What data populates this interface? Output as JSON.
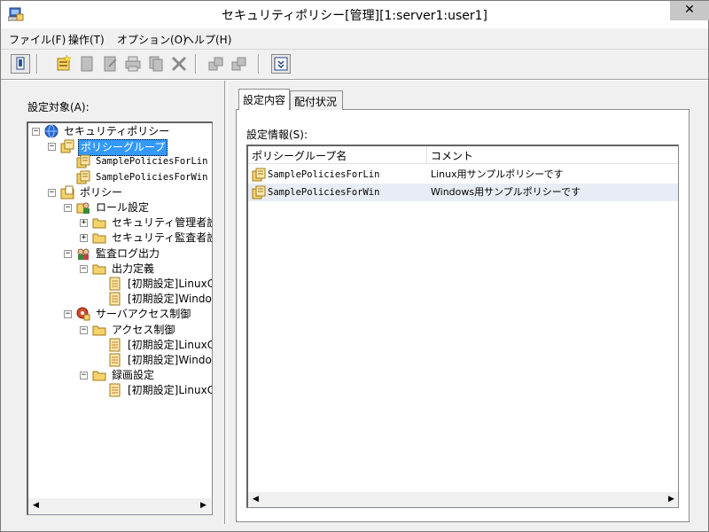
{
  "window": {
    "title": "セキュリティポリシー[管理][1:server1:user1]",
    "close_glyph": "✕"
  },
  "menu": [
    {
      "label": "ファイル(F)"
    },
    {
      "label": "操作(T)"
    },
    {
      "label": "オプション(O)"
    },
    {
      "label": "ヘルプ(H)"
    }
  ],
  "toolbar": {
    "buttons": [
      "open-icon",
      "new-policy-icon",
      "new-doc-icon",
      "edit-icon",
      "print-icon",
      "copy-icon",
      "delete-icon",
      "distribute-icon",
      "collect-icon",
      "dropdown-icon"
    ]
  },
  "left_pane": {
    "label": "設定対象(A):",
    "tree": [
      {
        "text": "セキュリティポリシー",
        "icon": "globe-icon",
        "expander": "−",
        "selected": false,
        "mono": false
      },
      {
        "text": "ポリシーグループ",
        "icon": "policy-group-icon",
        "expander": "−",
        "selected": true,
        "mono": false
      },
      {
        "text": "SamplePoliciesForLin",
        "icon": "policy-icon",
        "expander": "",
        "selected": false,
        "mono": true
      },
      {
        "text": "SamplePoliciesForWin",
        "icon": "policy-icon",
        "expander": "",
        "selected": false,
        "mono": true
      },
      {
        "text": "ポリシー",
        "icon": "policy-folder-icon",
        "expander": "−",
        "selected": false,
        "mono": false
      },
      {
        "text": "ロール設定",
        "icon": "role-icon",
        "expander": "−",
        "selected": false,
        "mono": false
      },
      {
        "text": "セキュリティ管理者設",
        "icon": "folder-icon",
        "expander": "+",
        "selected": false,
        "mono": false
      },
      {
        "text": "セキュリティ監査者設",
        "icon": "folder-icon",
        "expander": "+",
        "selected": false,
        "mono": false
      },
      {
        "text": "監査ログ出力",
        "icon": "audit-icon",
        "expander": "−",
        "selected": false,
        "mono": false
      },
      {
        "text": "出力定義",
        "icon": "folder-icon",
        "expander": "−",
        "selected": false,
        "mono": false
      },
      {
        "text": "[初期設定]LinuxC",
        "icon": "document-icon",
        "expander": "",
        "selected": false,
        "mono": false
      },
      {
        "text": "[初期設定]Window",
        "icon": "document-icon",
        "expander": "",
        "selected": false,
        "mono": false
      },
      {
        "text": "サーバアクセス制御",
        "icon": "access-control-icon",
        "expander": "−",
        "selected": false,
        "mono": false
      },
      {
        "text": "アクセス制御",
        "icon": "folder-icon",
        "expander": "−",
        "selected": false,
        "mono": false
      },
      {
        "text": "[初期設定]LinuxC",
        "icon": "document-icon",
        "expander": "",
        "selected": false,
        "mono": false
      },
      {
        "text": "[初期設定]Window",
        "icon": "document-icon",
        "expander": "",
        "selected": false,
        "mono": false
      },
      {
        "text": "録画設定",
        "icon": "folder-icon",
        "expander": "−",
        "selected": false,
        "mono": false
      },
      {
        "text": "[初期設定]LinuxC",
        "icon": "document-icon",
        "expander": "",
        "selected": false,
        "mono": false
      }
    ],
    "scroll_left": "◀",
    "scroll_right": "▶"
  },
  "right_pane": {
    "tabs": [
      {
        "label": "設定内容",
        "active": true
      },
      {
        "label": "配付状況",
        "active": false
      }
    ],
    "info_label": "設定情報(S):",
    "columns": [
      "ポリシーグループ名",
      "コメント"
    ],
    "rows": [
      {
        "name": "SamplePoliciesForLin",
        "comment": "Linux用サンプルポリシーです"
      },
      {
        "name": "SamplePoliciesForWin",
        "comment": "Windows用サンプルポリシーです"
      }
    ],
    "scroll_left": "◀",
    "scroll_right": "▶"
  },
  "colors": {
    "selection": "#3399ff",
    "folder": "#f5d36b",
    "policy": "#e8a848",
    "globe": "#2a6dd6"
  }
}
